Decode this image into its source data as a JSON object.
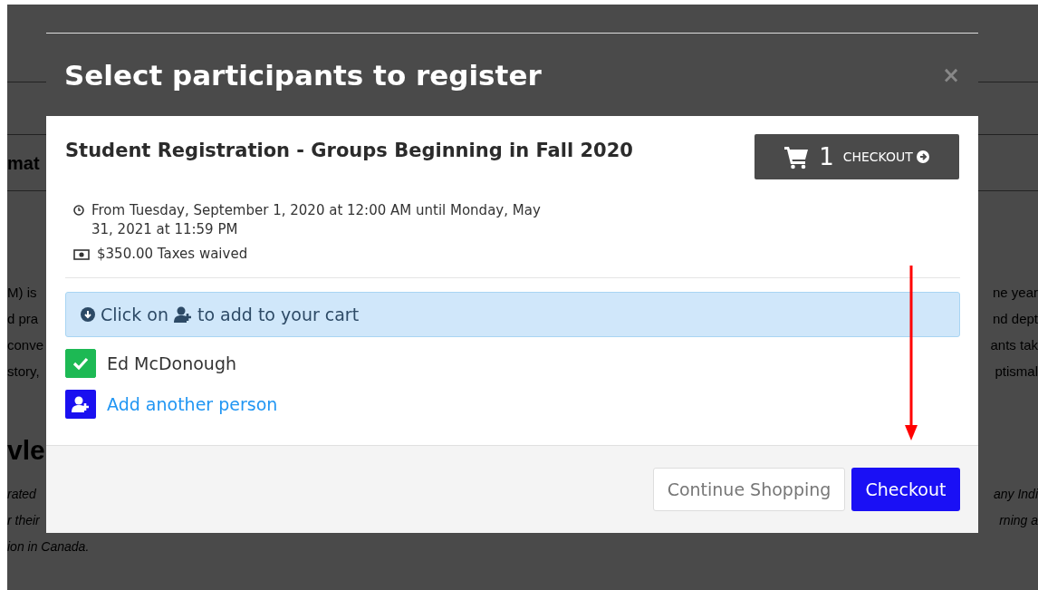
{
  "background": {
    "heading_1": "mat",
    "paragraph_left": [
      "M) is",
      "d pra",
      "conve",
      "story,"
    ],
    "paragraph_right": [
      "ne year",
      "nd dept",
      "ants tak",
      "ptismal"
    ],
    "heading_2": "vle",
    "italic_left": [
      "rated",
      "r their",
      "ion in Canada."
    ],
    "italic_right": [
      "any Indi",
      "rning a"
    ]
  },
  "modal": {
    "title": "Select participants to register",
    "close": "×",
    "event_title": "Student Registration - Groups Beginning in Fall 2020",
    "cart": {
      "count": "1",
      "label": "CHECKOUT"
    },
    "schedule": "From Tuesday, September 1, 2020 at 12:00 AM until Monday, May 31, 2021 at 11:59 PM",
    "price": "$350.00 Taxes waived",
    "hint": {
      "before": "Click on",
      "after": "to add to your cart"
    },
    "participants": [
      {
        "name": "Ed McDonough",
        "checked": true
      }
    ],
    "add_person": "Add another person",
    "buttons": [
      {
        "label": "Continue Shopping",
        "kind": "secondary"
      },
      {
        "label": "Checkout",
        "kind": "primary"
      }
    ]
  }
}
